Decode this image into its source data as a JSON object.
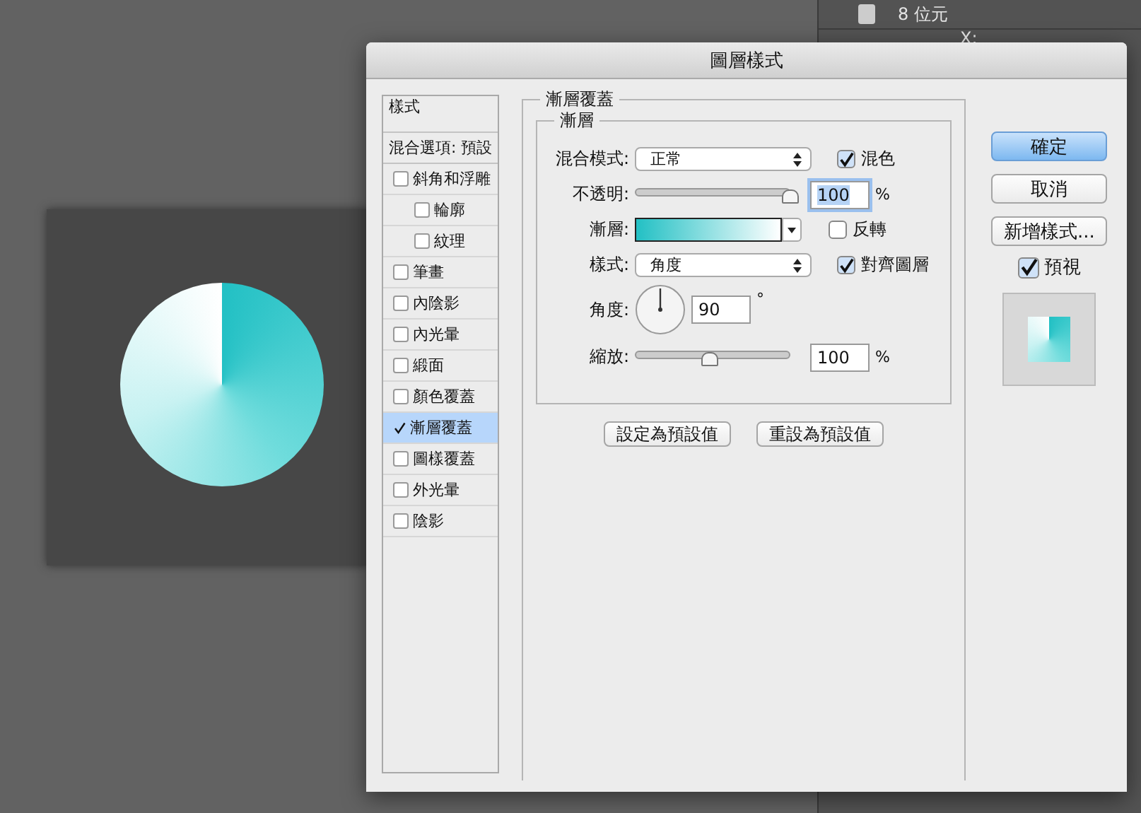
{
  "window": {
    "title": "圖層樣式"
  },
  "background_panel": {
    "texts": [
      "8 位元",
      "X:"
    ]
  },
  "styles_list": {
    "header": "樣式",
    "blend_options": "混合選項: 預設",
    "items": [
      {
        "label": "斜角和浮雕",
        "checked": false,
        "selected": false,
        "children": [
          {
            "label": "輪廓",
            "checked": false,
            "selected": false
          },
          {
            "label": "紋理",
            "checked": false,
            "selected": false
          }
        ]
      },
      {
        "label": "筆畫",
        "checked": false,
        "selected": false
      },
      {
        "label": "內陰影",
        "checked": false,
        "selected": false
      },
      {
        "label": "內光暈",
        "checked": false,
        "selected": false
      },
      {
        "label": "緞面",
        "checked": false,
        "selected": false
      },
      {
        "label": "顏色覆蓋",
        "checked": false,
        "selected": false
      },
      {
        "label": "漸層覆蓋",
        "checked": true,
        "selected": true
      },
      {
        "label": "圖樣覆蓋",
        "checked": false,
        "selected": false
      },
      {
        "label": "外光暈",
        "checked": false,
        "selected": false
      },
      {
        "label": "陰影",
        "checked": false,
        "selected": false
      }
    ]
  },
  "section": {
    "title": "漸層覆蓋",
    "group_title": "漸層",
    "blend_mode": {
      "label": "混合模式:",
      "value": "正常"
    },
    "dither": {
      "label": "混色",
      "checked": true
    },
    "opacity": {
      "label": "不透明:",
      "level": 1.0,
      "value": "100",
      "unit": "%"
    },
    "gradient": {
      "label": "漸層:"
    },
    "reverse": {
      "label": "反轉",
      "checked": false
    },
    "style": {
      "label": "樣式:",
      "value": "角度"
    },
    "align": {
      "label": "對齊圖層",
      "checked": true
    },
    "angle": {
      "label": "角度:",
      "value": "90",
      "unit": "°"
    },
    "scale": {
      "label": "縮放:",
      "level": 0.47,
      "value": "100",
      "unit": "%"
    },
    "buttons": [
      "設定為預設值",
      "重設為預設值"
    ]
  },
  "actions": {
    "buttons": [
      {
        "label": "確定",
        "kind": "primary"
      },
      {
        "label": "取消",
        "kind": "normal"
      },
      {
        "label": "新增樣式...",
        "kind": "normal"
      }
    ],
    "preview": {
      "label": "預視",
      "checked": true
    }
  }
}
